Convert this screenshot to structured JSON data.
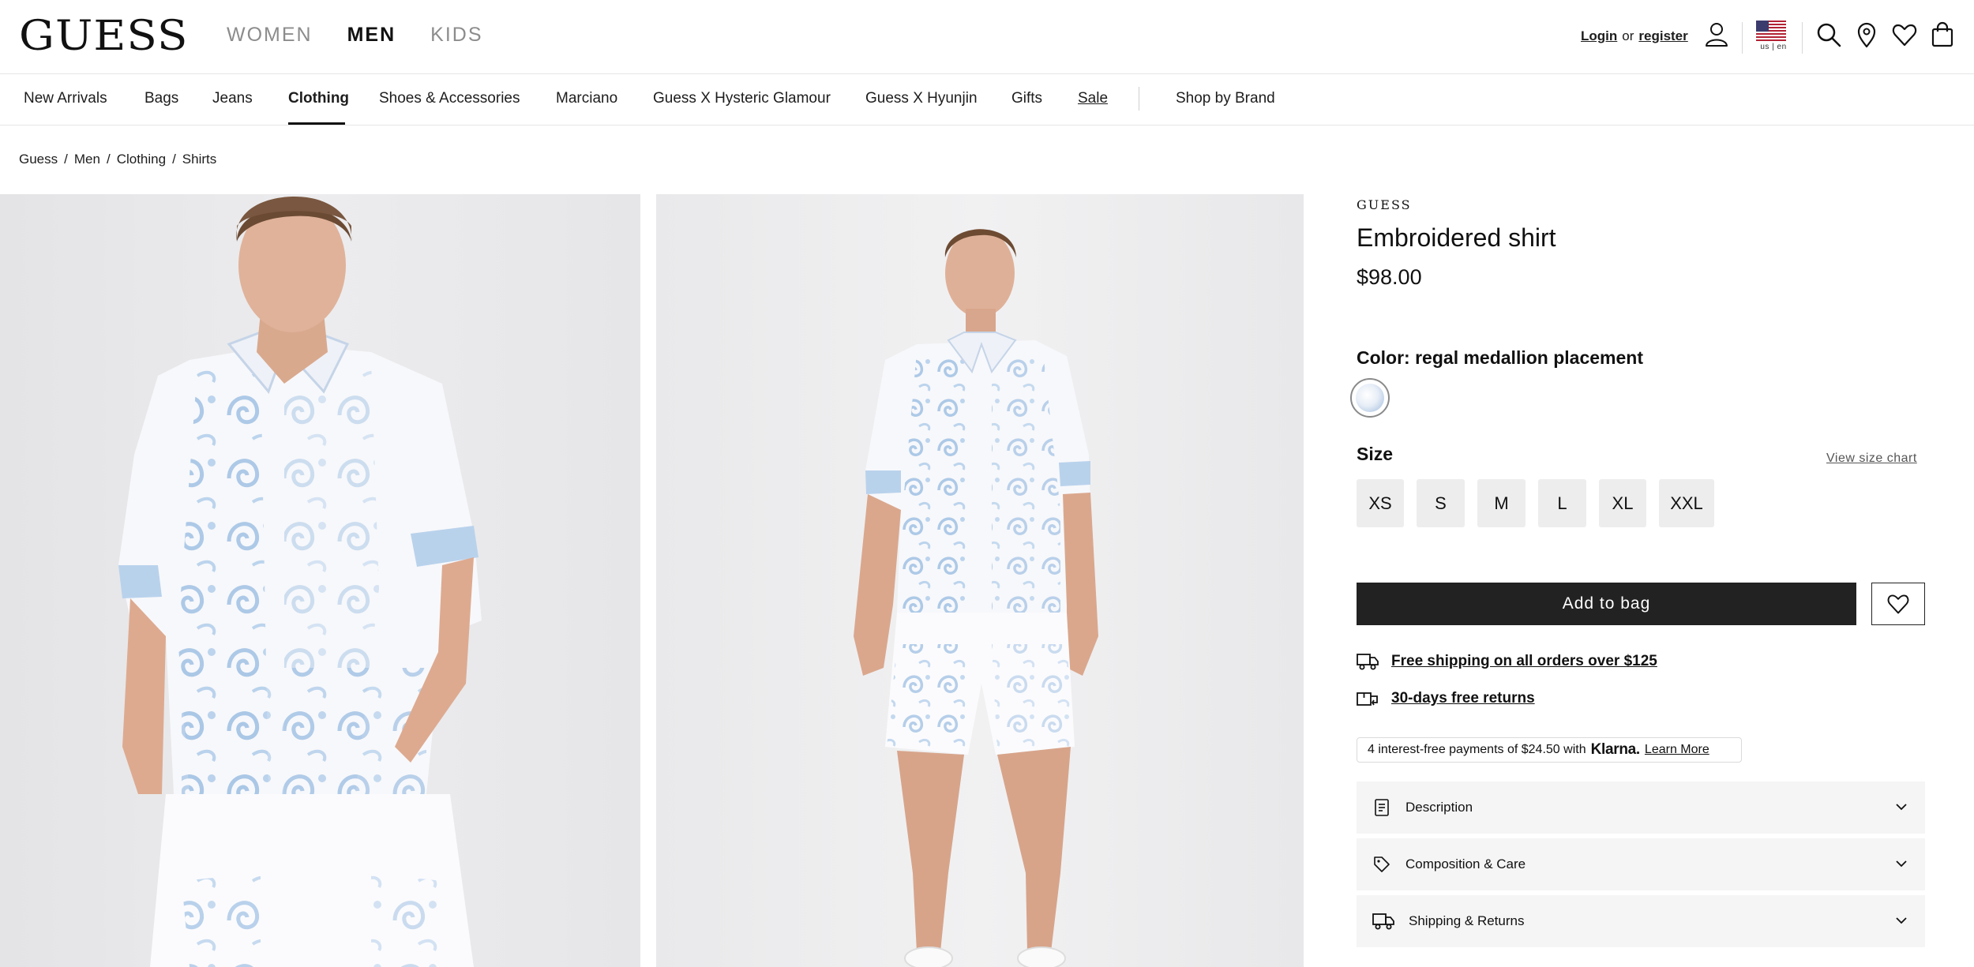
{
  "header": {
    "logo": "GUESS",
    "gender_tabs": [
      "WOMEN",
      "MEN",
      "KIDS"
    ],
    "active_gender": "MEN",
    "login_label": "Login",
    "or_label": "or",
    "register_label": "register",
    "locale_label": "us | en",
    "icons": [
      "user-icon",
      "us-flag-icon",
      "search-icon",
      "location-pin-icon",
      "heart-icon",
      "shopping-bag-icon"
    ]
  },
  "category_nav": {
    "items": [
      "New Arrivals",
      "Bags",
      "Jeans",
      "Clothing",
      "Shoes & Accessories",
      "Marciano",
      "Guess X Hysteric Glamour",
      "Guess X Hyunjin",
      "Gifts",
      "Sale",
      "Shop by Brand"
    ],
    "active": "Clothing"
  },
  "breadcrumb": [
    "Guess",
    "Men",
    "Clothing",
    "Shirts"
  ],
  "product": {
    "brand": "GUESS",
    "title": "Embroidered shirt",
    "price": "$98.00",
    "color_prefix": "Color:",
    "color_name": "regal medallion placement",
    "size_label": "Size",
    "size_chart_label": "View size chart",
    "sizes": [
      "XS",
      "S",
      "M",
      "L",
      "XL",
      "XXL"
    ],
    "add_to_bag_label": "Add to bag",
    "perks": {
      "shipping": "Free shipping on all orders over $125",
      "returns": "30-days free returns"
    },
    "klarna": {
      "text": "4 interest-free payments of $24.50 with",
      "brand": "Klarna.",
      "learn_more": "Learn More"
    },
    "accordions": [
      "Description",
      "Composition & Care",
      "Shipping & Returns"
    ]
  },
  "colors": {
    "primary_button": "#222222",
    "accordion_bg": "#f5f5f5",
    "size_button_bg": "#ededed",
    "print_blue": "#a9c6e6"
  }
}
